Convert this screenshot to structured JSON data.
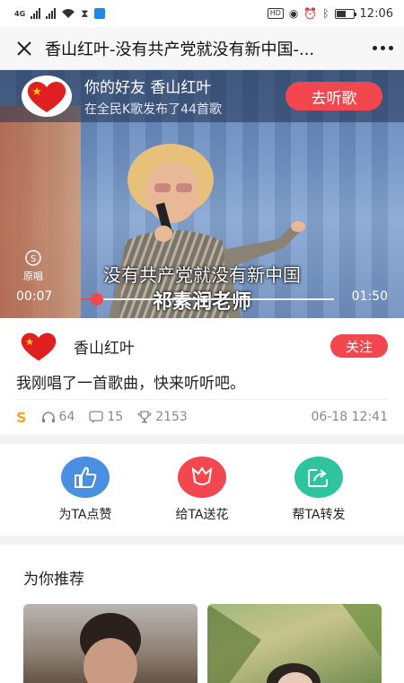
{
  "status_bar": {
    "network": "4G",
    "time": "12:06",
    "hd": "HD",
    "battery_level": 0.6
  },
  "header": {
    "title": "香山红叶-没有共产党就没有新中国-...",
    "close_icon": "close-icon",
    "more_icon": "more-dots-icon"
  },
  "video": {
    "friend_name": "你的好友 香山红叶",
    "friend_sub": "在全民K歌发布了44首歌",
    "listen_button": "去听歌",
    "original_label": "原唱",
    "lyric_line1": "没有共产党就没有新中国",
    "lyric_line2": "祁素润老师",
    "time_current": "00:07",
    "time_total": "01:50",
    "progress": 0.064
  },
  "author": {
    "name": "香山红叶",
    "follow_button": "关注",
    "message": "我刚唱了一首歌曲，快来听听吧。",
    "s_mark": "S",
    "listens": "64",
    "comments": "15",
    "gifts": "2153",
    "date": "06-18 12:41"
  },
  "actions": [
    {
      "label": "为TA点赞",
      "icon": "thumbs-up-icon",
      "color": "#4a90e2"
    },
    {
      "label": "给TA送花",
      "icon": "tulip-icon",
      "color": "#f2474f"
    },
    {
      "label": "帮TA转发",
      "icon": "share-icon",
      "color": "#2ec4a0"
    }
  ],
  "recommend": {
    "title": "为你推荐"
  }
}
